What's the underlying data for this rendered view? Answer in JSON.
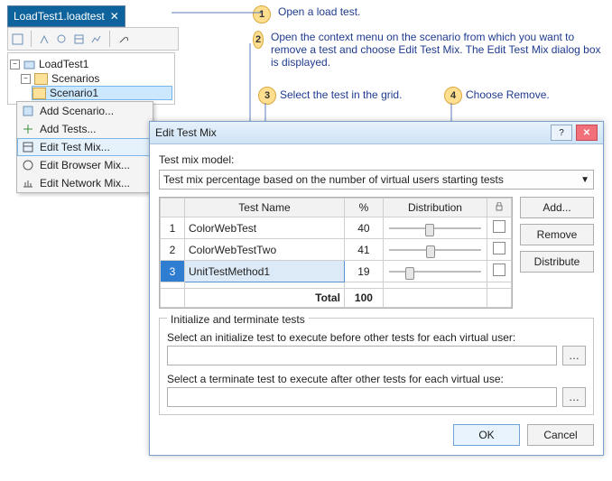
{
  "tab": {
    "title": "LoadTest1.loadtest",
    "close": "✕"
  },
  "tree": {
    "root": "LoadTest1",
    "scenarios_label": "Scenarios",
    "scenario_selected": "Scenario1"
  },
  "context_menu": {
    "items": [
      "Add Scenario...",
      "Add Tests...",
      "Edit Test Mix...",
      "Edit Browser Mix...",
      "Edit Network Mix..."
    ]
  },
  "callouts": {
    "c1": "Open a load test.",
    "c2": "Open the context menu on the scenario from which you want to remove a test and choose Edit Test Mix. The Edit Test Mix dialog box is displayed.",
    "c3": "Select the test in the grid.",
    "c4": "Choose Remove."
  },
  "dialog": {
    "title": "Edit Test Mix",
    "model_label": "Test mix model:",
    "model_value": "Test mix percentage based on the number of virtual users starting tests",
    "headers": {
      "name": "Test Name",
      "pct": "%",
      "dist": "Distribution"
    },
    "rows": [
      {
        "n": "1",
        "name": "ColorWebTest",
        "pct": "40",
        "slider": 40
      },
      {
        "n": "2",
        "name": "ColorWebTestTwo",
        "pct": "41",
        "slider": 41
      },
      {
        "n": "3",
        "name": "UnitTestMethod1",
        "pct": "19",
        "slider": 19
      }
    ],
    "total_label": "Total",
    "total_value": "100",
    "buttons": {
      "add": "Add...",
      "remove": "Remove",
      "distribute": "Distribute"
    },
    "fieldset_title": "Initialize and terminate tests",
    "init_label": "Select an initialize test to execute before other tests for each virtual user:",
    "term_label": "Select a terminate test to execute after other tests for each virtual use:",
    "ok": "OK",
    "cancel": "Cancel",
    "help": "?",
    "close": "✕",
    "ellipsis": "…"
  }
}
